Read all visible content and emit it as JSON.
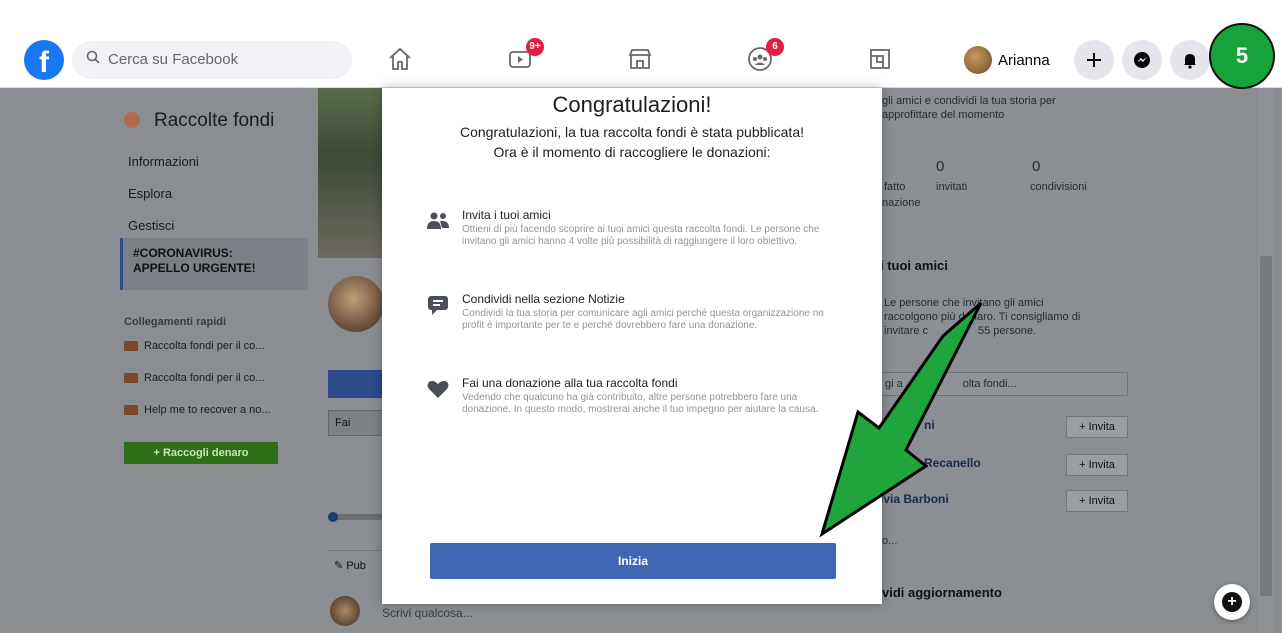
{
  "topbar": {
    "search_placeholder": "Cerca su Facebook",
    "watch_badge": "9+",
    "groups_badge": "6",
    "user_name": "Arianna"
  },
  "step_marker": "5",
  "left_nav": {
    "title": "Raccolte fondi",
    "links": [
      "Informazioni",
      "Esplora",
      "Gestisci"
    ],
    "active_line1": "#CORONAVIRUS:",
    "active_line2": "APPELLO URGENTE!",
    "quick_title": "Collegamenti rapidi",
    "quick_links": [
      "Raccolta fondi per il co...",
      "Raccolta fondi per il co...",
      "Help me to recover a no..."
    ],
    "raise_button": "+ Raccogli denaro"
  },
  "middle": {
    "fai_label": "Fai",
    "publish_label": "Pub",
    "composer_placeholder": "Scrivi qualcosa..."
  },
  "right": {
    "top_text_1": "gli amici e condividi la tua storia per",
    "top_text_2": "approfittare del momento",
    "stat1_value": "0",
    "stat2_value": "0",
    "stat_fatto": "fatto",
    "stat_nazione": "nazione",
    "stat_invitati": "invitati",
    "stat_condivisioni": "condivisioni",
    "friends_heading": "i tuoi amici",
    "friends_text_1": "Le persone che invitano gli amici",
    "friends_text_2": "raccolgono più denaro. Ti consigliamo di",
    "friends_text_3": "invitare c",
    "friends_text_4": "55 persone.",
    "input_text_1": "gi a",
    "input_text_2": "olta fondi...",
    "friend1": "ni",
    "friend2": "Recanello",
    "friend3": "ivia Barboni",
    "invite_label": "+ Invita",
    "more_stub": "o...",
    "share_heading": "vidi aggiornamento"
  },
  "modal": {
    "title": "Congratulazioni!",
    "subtitle": "Congratulazioni, la tua raccolta fondi è stata pubblicata! Ora è il momento di raccogliere le donazioni:",
    "tips": [
      {
        "icon": "people-icon",
        "heading": "Invita i tuoi amici",
        "desc": "Ottieni di più facendo scoprire ai tuoi amici questa raccolta fondi. Le persone che invitano gli amici hanno 4 volte più possibilità di raggiungere il loro obiettivo."
      },
      {
        "icon": "share-icon",
        "heading": "Condividi nella sezione Notizie",
        "desc": "Condividi la tua storia per comunicare agli amici perché questa organizzazione no profit è importante per te e perché dovrebbero fare una donazione."
      },
      {
        "icon": "heart-icon",
        "heading": "Fai una donazione alla tua raccolta fondi",
        "desc": "Vedendo che qualcuno ha già contribuito, altre persone potrebbero fare una donazione. In questo modo, mostrerai anche il tuo impegno per aiutare la causa."
      }
    ],
    "button": "Inizia"
  },
  "colors": {
    "facebook_blue": "#1877f2",
    "button_blue": "#4267b2",
    "annotation_green": "#16a33b",
    "badge_red": "#e41e3f"
  }
}
